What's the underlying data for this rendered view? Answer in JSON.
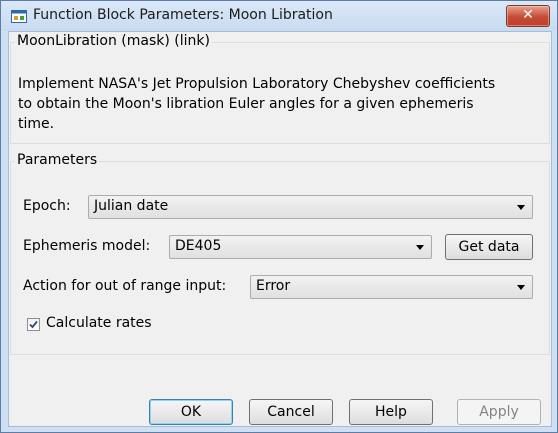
{
  "window": {
    "title": "Function Block Parameters: Moon Libration",
    "close_label": "✕"
  },
  "mask_group": {
    "title": "MoonLibration (mask) (link)",
    "description_lines": [
      "Implement NASA's Jet Propulsion Laboratory Chebyshev coefficients",
      "to obtain the Moon's libration Euler angles for a given ephemeris",
      "time."
    ]
  },
  "parameters": {
    "title": "Parameters",
    "epoch": {
      "label": "Epoch:",
      "value": "Julian date"
    },
    "ephemeris_model": {
      "label": "Ephemeris model:",
      "value": "DE405",
      "get_data_label": "Get data"
    },
    "action": {
      "label": "Action for out of range input:",
      "value": "Error"
    },
    "calculate_rates": {
      "label": "Calculate rates",
      "checked": true
    }
  },
  "buttons": {
    "ok": "OK",
    "cancel": "Cancel",
    "help": "Help",
    "apply": "Apply"
  }
}
